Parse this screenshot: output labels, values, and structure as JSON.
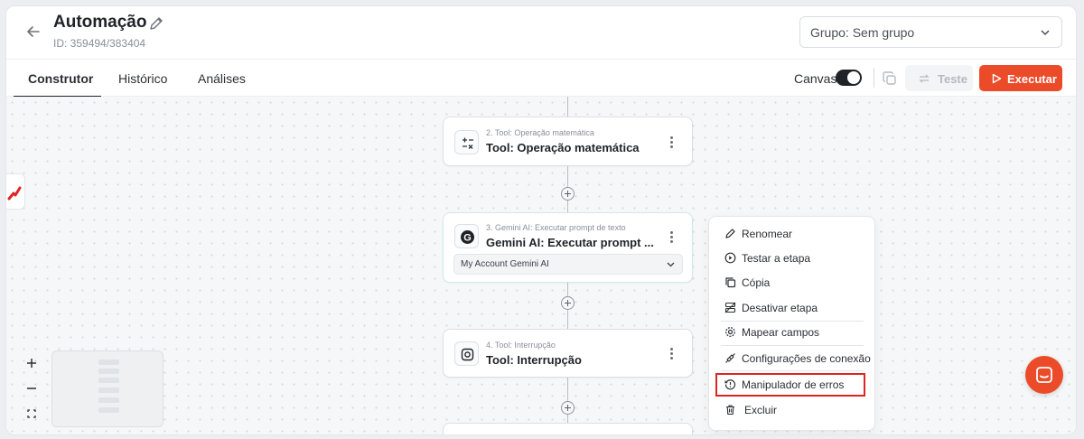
{
  "header": {
    "title": "Automação",
    "id_text": "ID: 359494/383404",
    "group_select": {
      "value": "Grupo: Sem grupo"
    }
  },
  "tabs": [
    {
      "label": "Construtor",
      "active": true
    },
    {
      "label": "Histórico",
      "active": false
    },
    {
      "label": "Análises",
      "active": false
    }
  ],
  "toolbar": {
    "canvas_label": "Canvas",
    "canvas_toggle_on": true,
    "test_label": "Teste",
    "run_label": "Executar"
  },
  "nodes": [
    {
      "subtitle": "2. Tool: Operação matemática",
      "title": "Tool: Operação matemática",
      "icon": "calculator-icon"
    },
    {
      "subtitle": "3. Gemini AI: Executar prompt de texto",
      "title": "Gemini AI: Executar prompt ...",
      "icon": "gemini-logo-icon",
      "account": "My Account Gemini AI"
    },
    {
      "subtitle": "4. Tool: Interrupção",
      "title": "Tool: Interrupção",
      "icon": "stop-icon"
    }
  ],
  "context_menu": {
    "items": [
      {
        "label": "Renomear",
        "icon": "pencil-icon"
      },
      {
        "label": "Testar a etapa",
        "icon": "play-circle-icon"
      },
      {
        "label": "Cópia",
        "icon": "copy-icon"
      },
      {
        "label": "Desativar etapa",
        "icon": "disable-icon"
      },
      {
        "label": "Mapear campos",
        "icon": "gear-icon"
      },
      {
        "label": "Configurações de conexão",
        "icon": "plug-icon"
      },
      {
        "label": "Manipulador de erros",
        "icon": "error-handler-icon",
        "highlighted": true
      },
      {
        "label": "Excluir",
        "icon": "trash-icon"
      }
    ]
  },
  "colors": {
    "accent": "#ec4b2a",
    "highlight_border": "#e02424",
    "selected_node_border": "#cdebe6"
  }
}
